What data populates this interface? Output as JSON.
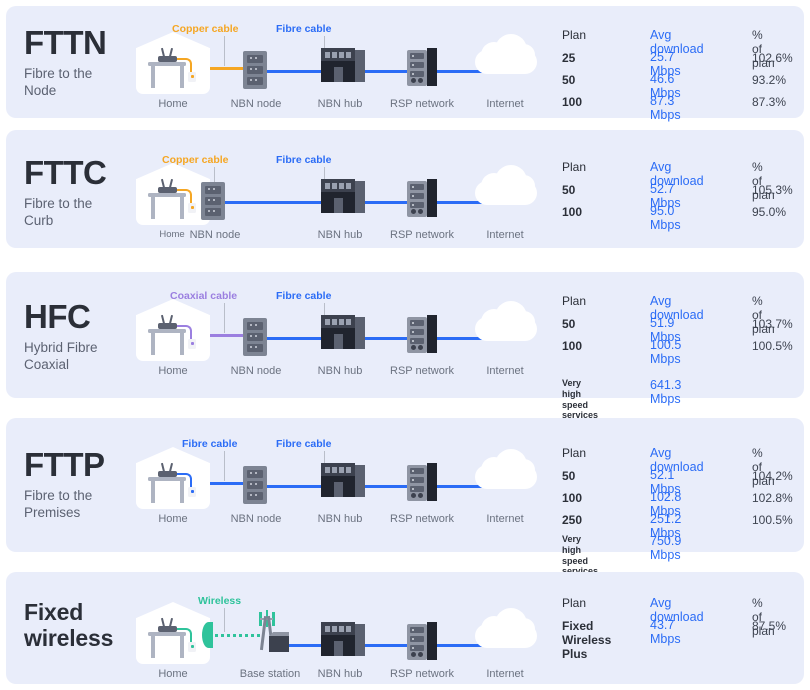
{
  "colors": {
    "card_bg": "#e9edfa",
    "copper": "#f5a623",
    "fibre": "#2b6cf6",
    "coaxial": "#9b7fe0",
    "wireless": "#2fc39b",
    "speed_text": "#2b6cf6",
    "title": "#2b2f38",
    "muted": "#6b7280"
  },
  "table_headers": {
    "plan": "Plan",
    "speed": "Avg download",
    "pct": "% of plan"
  },
  "node_labels": {
    "home": "Home",
    "nbn_node": "NBN node",
    "nbn_hub": "NBN hub",
    "rsp": "RSP network",
    "internet": "Internet",
    "base_station": "Base station"
  },
  "legend_labels": {
    "copper": "Copper cable",
    "fibre": "Fibre cable",
    "coaxial": "Coaxial cable",
    "wireless": "Wireless"
  },
  "very_high": "Very high\nspeed services",
  "rows": [
    {
      "abbr": "FTTN",
      "name": "Fibre to the\nNode",
      "first_link": "copper",
      "first_link_label": "Copper cable",
      "second_link_label": "Fibre cable",
      "plans": [
        {
          "plan": "25",
          "speed": "25.7 Mbps",
          "pct": "102.6%"
        },
        {
          "plan": "50",
          "speed": "46.6 Mbps",
          "pct": "93.2%"
        },
        {
          "plan": "100",
          "speed": "87.3 Mbps",
          "pct": "87.3%"
        }
      ]
    },
    {
      "abbr": "FTTC",
      "name": "Fibre to the\nCurb",
      "first_link": "copper",
      "first_link_label": "Copper cable",
      "second_link_label": "Fibre cable",
      "plans": [
        {
          "plan": "50",
          "speed": "52.7 Mbps",
          "pct": "105.3%"
        },
        {
          "plan": "100",
          "speed": "95.0 Mbps",
          "pct": "95.0%"
        }
      ]
    },
    {
      "abbr": "HFC",
      "name": "Hybrid Fibre\nCoaxial",
      "first_link": "coaxial",
      "first_link_label": "Coaxial cable",
      "second_link_label": "Fibre cable",
      "plans": [
        {
          "plan": "50",
          "speed": "51.9 Mbps",
          "pct": "103.7%"
        },
        {
          "plan": "100",
          "speed": "100.5 Mbps",
          "pct": "100.5%"
        }
      ],
      "very_high_speed": "641.3 Mbps"
    },
    {
      "abbr": "FTTP",
      "name": "Fibre to the\nPremises",
      "first_link": "fibre",
      "first_link_label": "Fibre cable",
      "second_link_label": "Fibre cable",
      "plans": [
        {
          "plan": "50",
          "speed": "52.1 Mbps",
          "pct": "104.2%"
        },
        {
          "plan": "100",
          "speed": "102.8 Mbps",
          "pct": "102.8%"
        },
        {
          "plan": "250",
          "speed": "251.2 Mbps",
          "pct": "100.5%"
        }
      ],
      "very_high_speed": "750.9 Mbps"
    },
    {
      "abbr": "Fixed\nwireless",
      "name": "",
      "first_link": "wireless",
      "first_link_label": "Wireless",
      "second_link_label": "",
      "plans": [
        {
          "plan": "Fixed\nWireless\nPlus",
          "speed": "43.7 Mbps",
          "pct": "87.5%"
        }
      ]
    }
  ]
}
